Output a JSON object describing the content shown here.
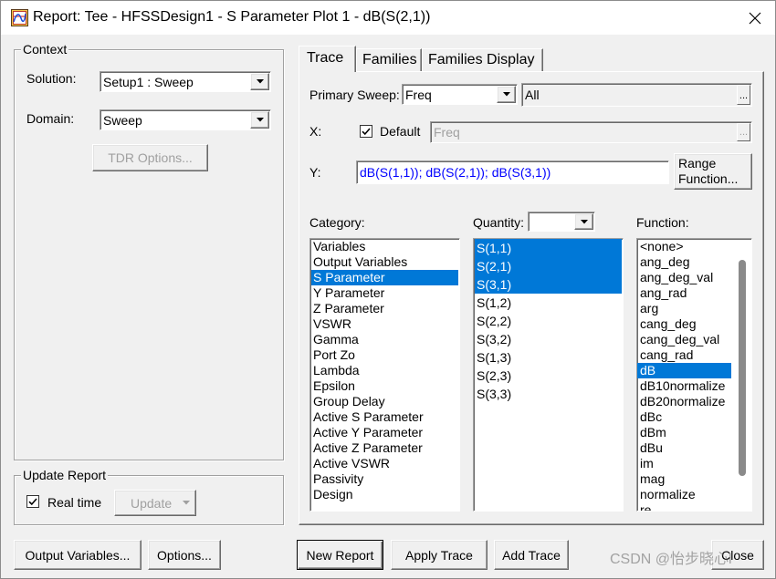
{
  "window": {
    "title": "Report: Tee - HFSSDesign1 - S Parameter Plot 1 - dB(S(2,1))",
    "app_icon": "report-plot-icon",
    "close_icon": "close-icon"
  },
  "colors": {
    "dialog_bg": "#f0f0f0",
    "selection_bg": "#0078d7",
    "selection_text": "#ffffff",
    "expression_text": "#0000ff",
    "disabled_text": "#a0a0a0"
  },
  "context": {
    "group_label": "Context",
    "solution_label": "Solution:",
    "solution_value": "Setup1 : Sweep",
    "domain_label": "Domain:",
    "domain_value": "Sweep",
    "tdr_options_button": "TDR Options...",
    "tdr_options_enabled": false
  },
  "update_report": {
    "group_label": "Update Report",
    "real_time_label": "Real time",
    "real_time_checked": true,
    "update_button": "Update",
    "update_enabled": false
  },
  "tabs": [
    {
      "label": "Trace",
      "active": true
    },
    {
      "label": "Families",
      "active": false
    },
    {
      "label": "Families Display",
      "active": false
    }
  ],
  "trace": {
    "primary_sweep_label": "Primary Sweep:",
    "primary_sweep_value": "Freq",
    "primary_sweep_range": "All",
    "x_label": "X:",
    "x_default_label": "Default",
    "x_default_checked": true,
    "x_value": "Freq",
    "y_label": "Y:",
    "y_expression": "dB(S(1,1)); dB(S(2,1)); dB(S(3,1))",
    "range_function_line1": "Range",
    "range_function_line2": "Function...",
    "browse_label": "..."
  },
  "category": {
    "label": "Category:",
    "items": [
      "Variables",
      "Output Variables",
      "S Parameter",
      "Y Parameter",
      "Z Parameter",
      "VSWR",
      "Gamma",
      "Port Zo",
      "Lambda",
      "Epsilon",
      "Group Delay",
      "Active S Parameter",
      "Active Y Parameter",
      "Active Z Parameter",
      "Active VSWR",
      "Passivity",
      "Design"
    ],
    "selected": [
      "S Parameter"
    ]
  },
  "quantity": {
    "label": "Quantity:",
    "items": [
      "S(1,1)",
      "S(2,1)",
      "S(3,1)",
      "S(1,2)",
      "S(2,2)",
      "S(3,2)",
      "S(1,3)",
      "S(2,3)",
      "S(3,3)"
    ],
    "selected": [
      "S(1,1)",
      "S(2,1)",
      "S(3,1)"
    ]
  },
  "function": {
    "label": "Function:",
    "items": [
      "<none>",
      "ang_deg",
      "ang_deg_val",
      "ang_rad",
      "arg",
      "cang_deg",
      "cang_deg_val",
      "cang_rad",
      "dB",
      "dB10normalize",
      "dB20normalize",
      "dBc",
      "dBm",
      "dBu",
      "im",
      "mag",
      "normalize",
      "re"
    ],
    "selected": [
      "dB"
    ]
  },
  "buttons": {
    "output_variables": "Output Variables...",
    "options": "Options...",
    "new_report": "New Report",
    "apply_trace": "Apply Trace",
    "add_trace": "Add Trace",
    "close": "Close"
  },
  "watermark": "CSDN @怡步晓心l"
}
